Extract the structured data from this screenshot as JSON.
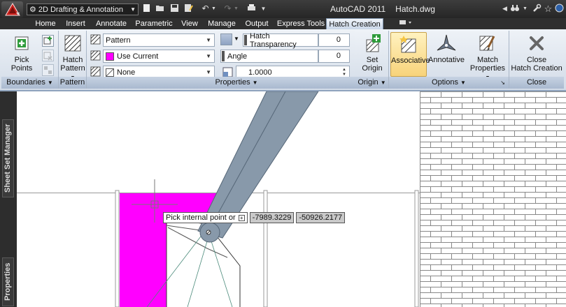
{
  "window": {
    "app_name": "AutoCAD 2011",
    "file_name": "Hatch.dwg"
  },
  "workspace": {
    "selected": "2D Drafting & Annotation"
  },
  "ribbon_tabs": [
    "Home",
    "Insert",
    "Annotate",
    "Parametric",
    "View",
    "Manage",
    "Output",
    "Express Tools",
    "Hatch Creation"
  ],
  "active_tab": "Hatch Creation",
  "boundaries": {
    "pick_points_label": "Pick Points",
    "panel_title": "Boundaries"
  },
  "pattern_panel": {
    "hatch_pattern_line1": "Hatch",
    "hatch_pattern_line2": "Pattern",
    "panel_title": "Pattern"
  },
  "properties": {
    "type_combo": "Pattern",
    "color_combo": "Use Current",
    "background_combo": "None",
    "transparency_label": "Hatch Transparency",
    "transparency_value": "0",
    "angle_label": "Angle",
    "angle_value": "0",
    "scale_value": "1.0000",
    "panel_title": "Properties",
    "hatch_color": "#ff00ff"
  },
  "origin": {
    "set_origin_line1": "Set",
    "set_origin_line2": "Origin",
    "panel_title": "Origin"
  },
  "options": {
    "associative_label": "Associative",
    "annotative_label": "Annotative",
    "match_properties_line1": "Match",
    "match_properties_line2": "Properties",
    "panel_title": "Options"
  },
  "close": {
    "close_line1": "Close",
    "close_line2": "Hatch Creation",
    "panel_title": "Close"
  },
  "palettes": {
    "sheet_set_manager": "Sheet Set Manager",
    "properties": "Properties"
  },
  "cursor_prompt": {
    "prompt_text": "Pick internal point or",
    "x_coord": "-7989.3229",
    "y_coord": "-50926.2177"
  }
}
